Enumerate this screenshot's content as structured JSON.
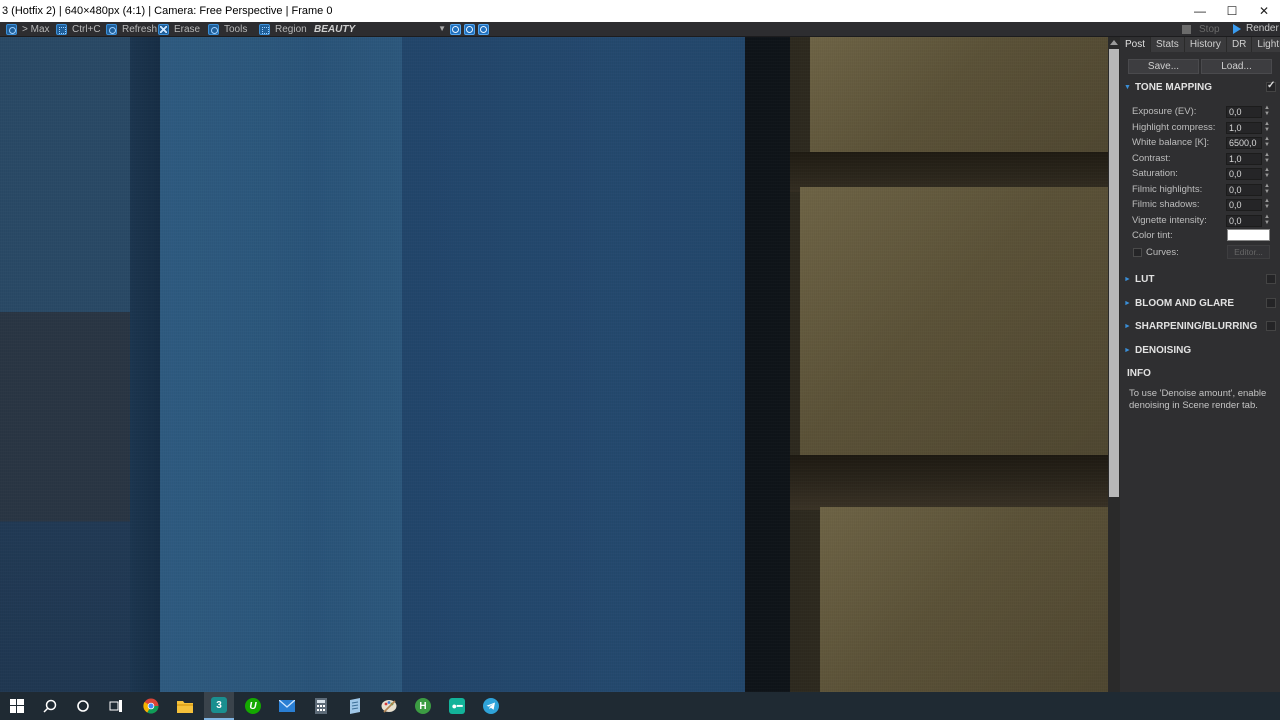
{
  "window": {
    "title": "3 (Hotfix 2) | 640×480px (4:1) | Camera: Free Perspective | Frame 0",
    "minimize": "—",
    "maximize": "☐",
    "close": "✕"
  },
  "toolbar": {
    "max_label": "> Max",
    "copy_label": "Ctrl+C",
    "refresh_label": "Refresh",
    "erase_label": "Erase",
    "tools_label": "Tools",
    "region_label": "Region",
    "region_value": "BEAUTY",
    "stop_label": "Stop",
    "render_label": "Render"
  },
  "panel": {
    "tabs": [
      {
        "label": "Post"
      },
      {
        "label": "Stats"
      },
      {
        "label": "History"
      },
      {
        "label": "DR"
      },
      {
        "label": "LightMix"
      }
    ],
    "save_label": "Save...",
    "load_label": "Load...",
    "tone_mapping": {
      "title": "TONE MAPPING",
      "enabled": true,
      "params": [
        {
          "label": "Exposure (EV):",
          "value": "0,0"
        },
        {
          "label": "Highlight compress:",
          "value": "1,0"
        },
        {
          "label": "White balance [K]:",
          "value": "6500,0"
        },
        {
          "label": "Contrast:",
          "value": "1,0"
        },
        {
          "label": "Saturation:",
          "value": "0,0"
        },
        {
          "label": "Filmic highlights:",
          "value": "0,0"
        },
        {
          "label": "Filmic shadows:",
          "value": "0,0"
        },
        {
          "label": "Vignette intensity:",
          "value": "0,0"
        }
      ],
      "color_tint_label": "Color tint:",
      "color_tint": "#ffffff",
      "curves_label": "Curves:",
      "editor_label": "Editor..."
    },
    "sections": [
      {
        "title": "LUT"
      },
      {
        "title": "BLOOM AND GLARE"
      },
      {
        "title": "SHARPENING/BLURRING"
      },
      {
        "title": "DENOISING"
      }
    ],
    "info": {
      "title": "INFO",
      "text": "To use 'Denoise amount', enable denoising in Scene render tab."
    }
  },
  "colors": {
    "accent": "#3a8fd8",
    "panel_bg": "#2f2f31",
    "viewport_blue": "#1e3a58",
    "brick": "#6e6446"
  },
  "taskbar": {
    "icons": [
      "windows-start-icon",
      "search-icon",
      "cortana-icon",
      "task-view-icon",
      "chrome-icon",
      "file-explorer-icon",
      "3dsmax-icon",
      "upwork-icon",
      "mail-icon",
      "calculator-icon",
      "notepad-icon",
      "paint-icon",
      "houdini-icon",
      "keepass-icon",
      "telegram-icon"
    ],
    "max_badge": "3",
    "upwork_badge": "U",
    "houdini_badge": "H"
  }
}
